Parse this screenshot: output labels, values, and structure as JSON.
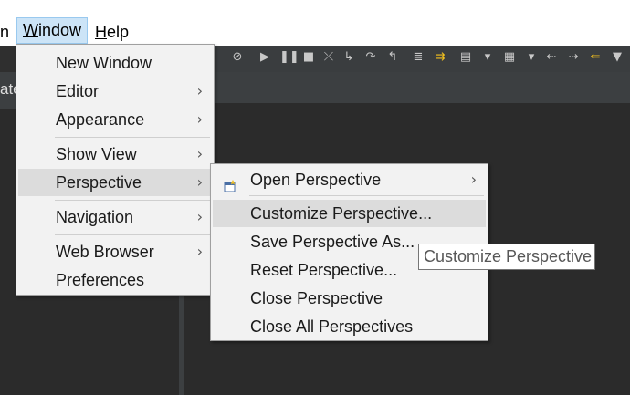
{
  "menubar": {
    "items": [
      {
        "label": "n",
        "active": false
      },
      {
        "label": "Window",
        "mnemonic": "W",
        "rest": "indow",
        "active": true
      },
      {
        "label": "Help",
        "mnemonic": "H",
        "rest": "elp",
        "active": false
      }
    ]
  },
  "left_panel": {
    "clipped_text": "ate"
  },
  "window_menu": {
    "items": [
      {
        "label": "New Window",
        "submenu": false
      },
      {
        "label": "Editor",
        "submenu": true
      },
      {
        "label": "Appearance",
        "submenu": true
      },
      {
        "label": "Show View",
        "submenu": true
      },
      {
        "label": "Perspective",
        "submenu": true,
        "highlighted": true
      },
      {
        "label": "Navigation",
        "submenu": true
      },
      {
        "label": "Web Browser",
        "submenu": true
      },
      {
        "label": "Preferences",
        "submenu": false
      }
    ],
    "arrow_glyph": "›"
  },
  "perspective_menu": {
    "items": [
      {
        "label": "Open Perspective",
        "submenu": true,
        "icon": "open-perspective-icon"
      },
      {
        "label": "Customize Perspective...",
        "submenu": false,
        "highlighted": true
      },
      {
        "label": "Save Perspective As...",
        "submenu": false
      },
      {
        "label": "Reset Perspective...",
        "submenu": false
      },
      {
        "label": "Close Perspective",
        "submenu": false
      },
      {
        "label": "Close All Perspectives",
        "submenu": false
      }
    ]
  },
  "tooltip": {
    "text": "Customize Perspective"
  },
  "toolbar": {
    "icons": [
      {
        "name": "skip-breakpoints-icon",
        "glyph": "⊘"
      },
      {
        "name": "resume-icon",
        "glyph": "▶"
      },
      {
        "name": "suspend-icon",
        "glyph": "❚❚"
      },
      {
        "name": "terminate-icon",
        "glyph": "■"
      },
      {
        "name": "disconnect-icon",
        "glyph": "⤫"
      },
      {
        "name": "step-into-icon",
        "glyph": "↳"
      },
      {
        "name": "step-over-icon",
        "glyph": "↷"
      },
      {
        "name": "step-return-icon",
        "glyph": "↰"
      },
      {
        "name": "drop-to-frame-icon",
        "glyph": "≣"
      },
      {
        "name": "use-step-filters-icon",
        "glyph": "⇉"
      },
      {
        "name": "open-type-icon",
        "glyph": "▤"
      },
      {
        "name": "dropdown-icon",
        "glyph": "▾"
      },
      {
        "name": "annotation-icon",
        "glyph": "▦"
      },
      {
        "name": "dropdown-icon",
        "glyph": "▾"
      },
      {
        "name": "back-icon",
        "glyph": "⇠"
      },
      {
        "name": "forward-icon",
        "glyph": "⇢"
      },
      {
        "name": "last-edit-icon",
        "glyph": "⇐"
      },
      {
        "name": "more-icon",
        "glyph": "▼"
      }
    ]
  },
  "colors": {
    "menu_bg": "#f2f2f2",
    "menu_highlight": "#dcdcdc",
    "menubar_active": "#cce4f7",
    "workbench_dark": "#2b2b2b",
    "accent_yellow": "#f2c01e"
  }
}
